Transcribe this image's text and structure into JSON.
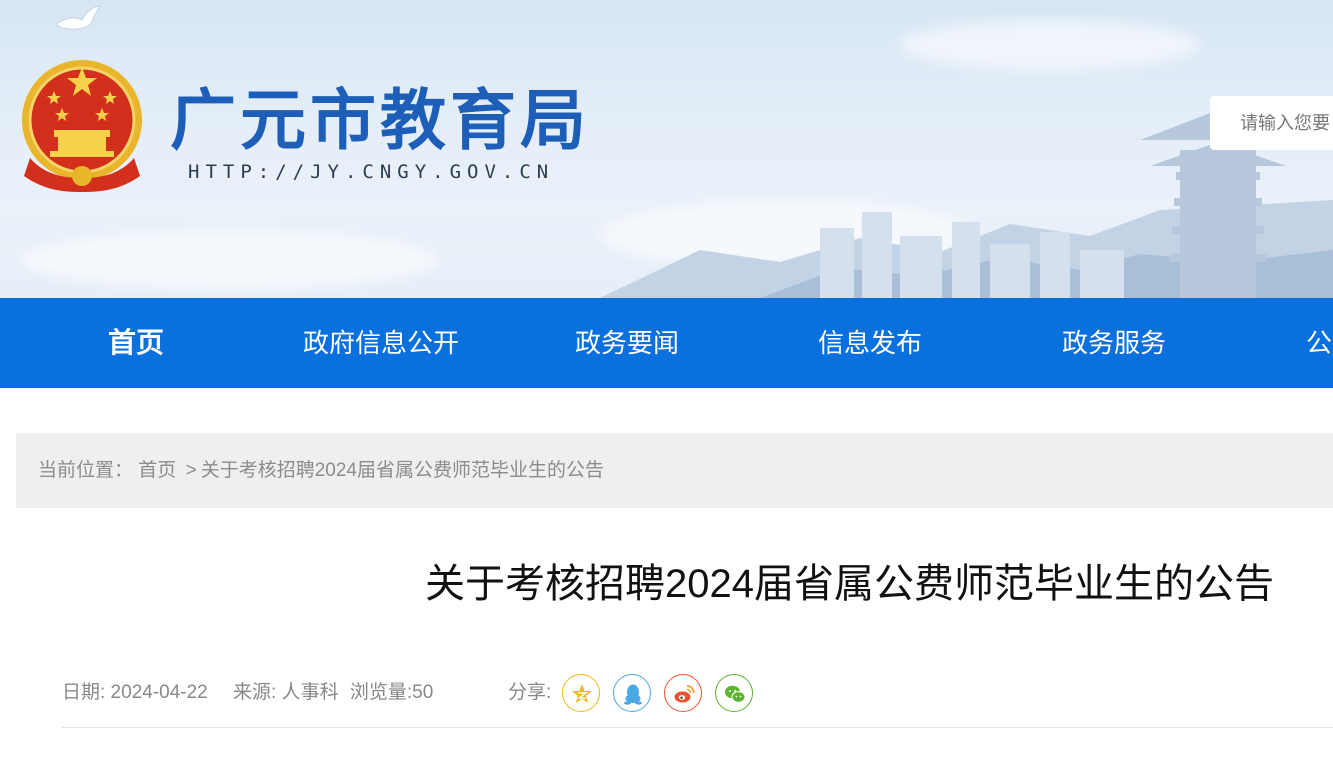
{
  "header": {
    "site_title": "广元市教育局",
    "site_url": "HTTP://JY.CNGY.GOV.CN",
    "search_placeholder": "请输入您要"
  },
  "nav": {
    "items": [
      {
        "label": "首页",
        "active": true
      },
      {
        "label": "政府信息公开",
        "active": false
      },
      {
        "label": "政务要闻",
        "active": false
      },
      {
        "label": "信息发布",
        "active": false
      },
      {
        "label": "政务服务",
        "active": false
      },
      {
        "label": "公",
        "active": false
      }
    ]
  },
  "breadcrumb": {
    "prefix": "当前位置：",
    "home": "首页",
    "separator": ">",
    "current": "关于考核招聘2024届省属公费师范毕业生的公告"
  },
  "article": {
    "title": "关于考核招聘2024届省属公费师范毕业生的公告",
    "date": "日期: 2024-04-22",
    "source": "来源: 人事科",
    "views": "浏览量:50",
    "share_label": "分享:"
  },
  "share": [
    {
      "icon": "qzone-star-icon",
      "color": "#f3b51d"
    },
    {
      "icon": "qq-penguin-icon",
      "color": "#4aa9e3"
    },
    {
      "icon": "weibo-icon",
      "color": "#e8532e"
    },
    {
      "icon": "wechat-icon",
      "color": "#5bb531"
    }
  ],
  "colors": {
    "nav_bg": "#0a70dd",
    "title_blue": "#1d5fb8",
    "crumb_bg": "#efefef"
  }
}
